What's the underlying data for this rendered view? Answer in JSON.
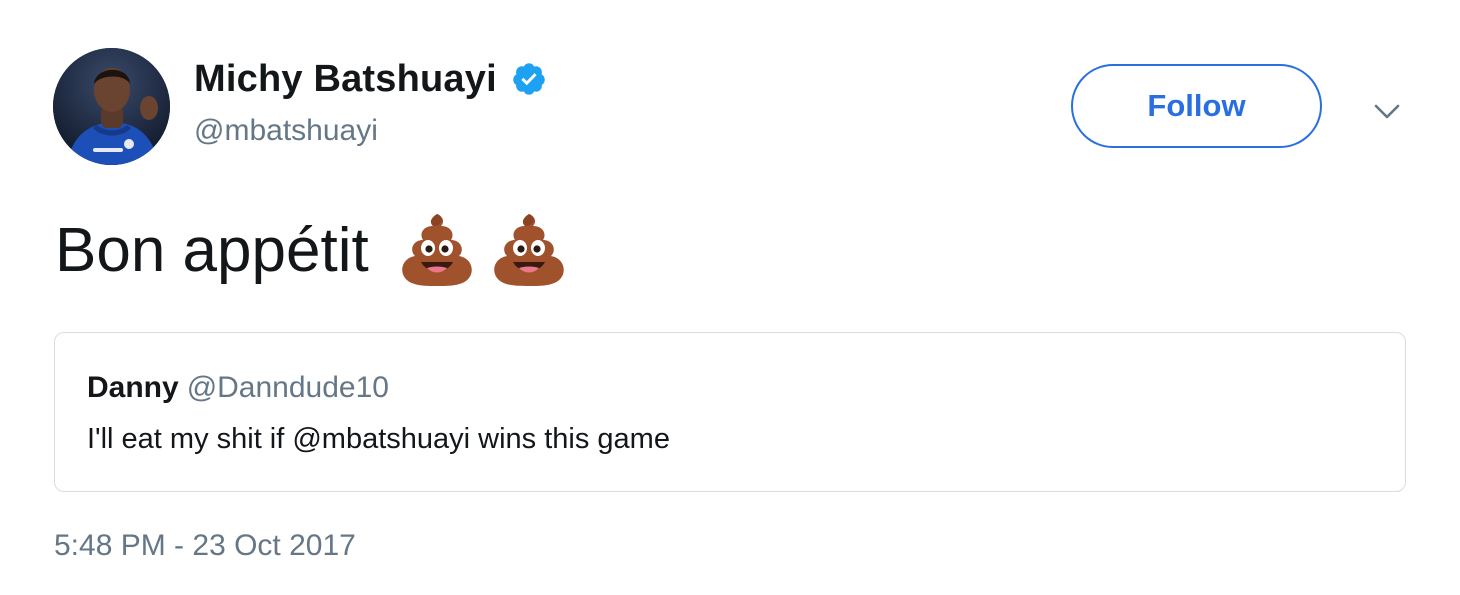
{
  "author": {
    "display_name": "Michy Batshuayi",
    "handle": "@mbatshuayi",
    "verified": true,
    "avatar_icon": "profile-photo"
  },
  "actions": {
    "follow_label": "Follow",
    "caret_icon": "chevron-down-icon"
  },
  "tweet": {
    "text": "Bon appétit",
    "emojis": [
      "pile-of-poo-emoji",
      "pile-of-poo-emoji"
    ]
  },
  "quoted_tweet": {
    "display_name": "Danny",
    "handle": "@Danndude10",
    "text": "I'll eat my shit if @mbatshuayi wins this game"
  },
  "timestamp": "5:48 PM - 23 Oct 2017",
  "colors": {
    "accent": "#2a6fe0",
    "verified_badge": "#1da1f2",
    "secondary_text": "#657786",
    "primary_text": "#14171a",
    "card_border": "#d6dde3"
  }
}
